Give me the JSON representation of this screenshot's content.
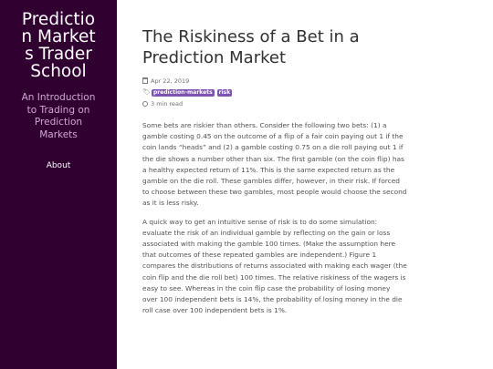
{
  "sidebar": {
    "title": "Prediction Markets Trader School",
    "tagline": "An Introduction to Trading on Prediction Markets",
    "nav": [
      {
        "label": "About"
      }
    ],
    "bg_color": "#300030",
    "tagline_color": "#d2a6d2"
  },
  "post": {
    "title": "The Riskiness of a Bet in a Prediction Market",
    "date": "Apr 22, 2019",
    "tags": [
      "prediction-markets",
      "risk"
    ],
    "tag_color": "#7d52b0",
    "read_time": "3 min read",
    "icons": {
      "date": "calendar-icon",
      "tags": "tags-icon",
      "read_time": "clock-icon"
    },
    "paragraphs": [
      "Some bets are riskier than others. Consider the following two bets: (1) a gamble costing 0.45 on the outcome of a flip of a fair coin paying out 1 if the coin lands “heads” and (2) a gamble costing 0.75 on a die roll paying out 1 if the die shows a number other than six. The first gamble (on the coin flip) has a healthy expected return of 11%. This is the same expected return as the gamble on the die roll. These gambles differ, however, in their risk. If forced to choose between these two gambles, most people would choose the second as it is less risky.",
      "A quick way to get an intuitive sense of risk is to do some simulation: evaluate the risk of an individual gamble by reflecting on the gain or loss associated with making the gamble 100 times. (Make the assumption here that outcomes of these repeated gambles are independent.) Figure 1 compares the distributions of returns associated with making each wager (the coin flip and the die roll bet) 100 times. The relative riskiness of the wagers is easy to see. Whereas in the coin flip case the probability of losing money over 100 independent bets is 14%, the probability of losing money in the die roll case over 100 independent bets is 1%."
    ]
  }
}
